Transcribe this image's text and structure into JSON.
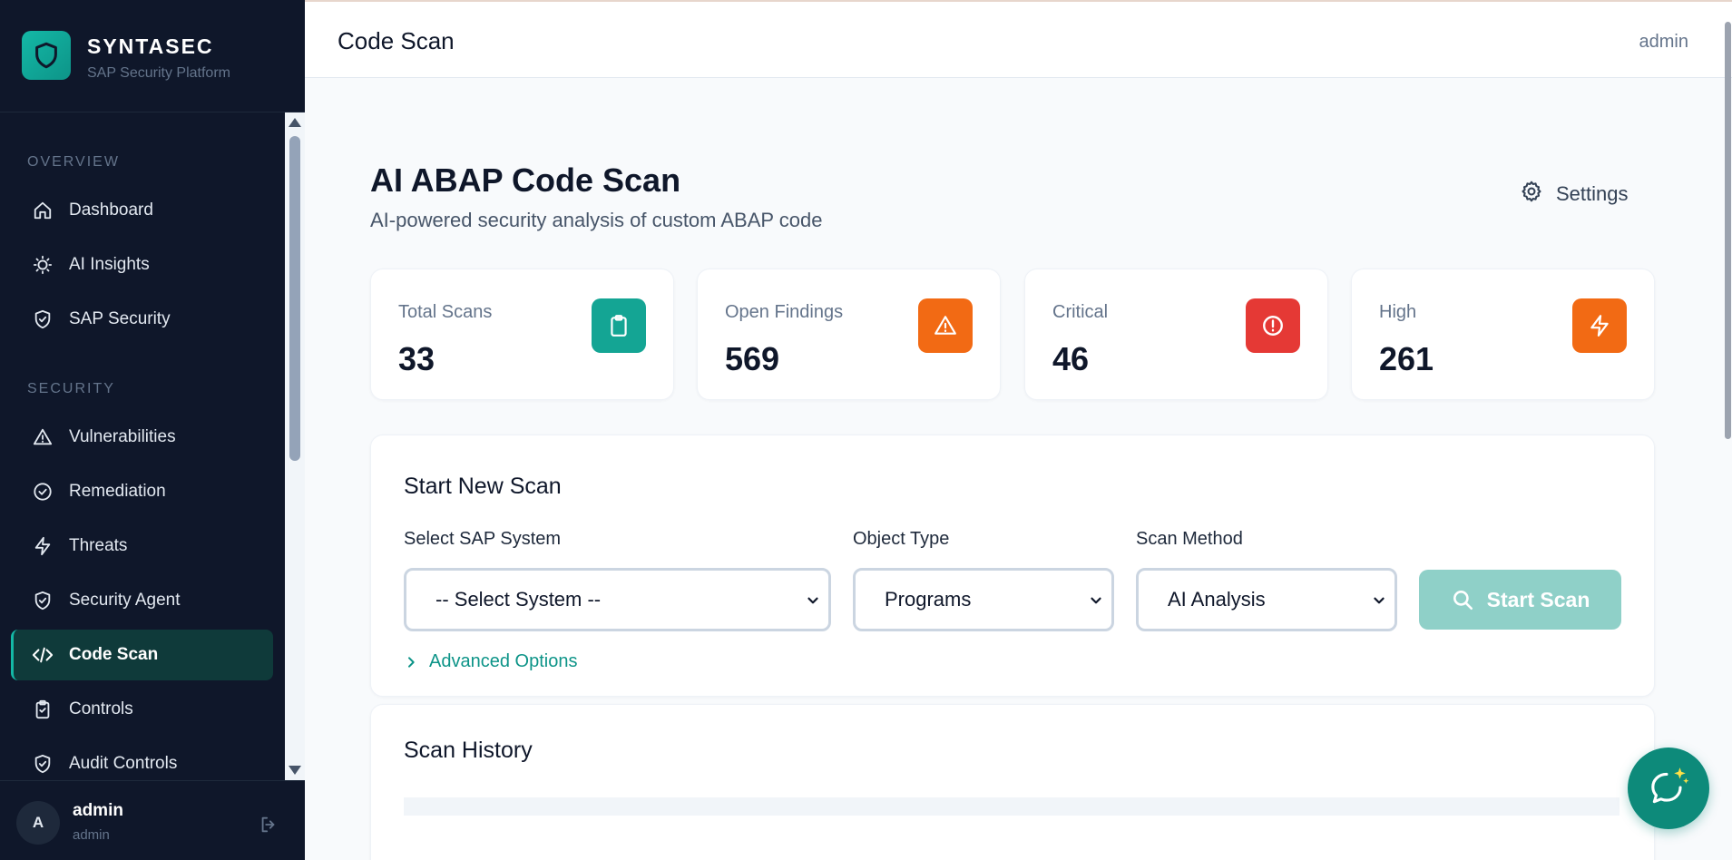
{
  "brand": {
    "name": "SYNTASEC",
    "subtitle": "SAP Security Platform"
  },
  "sidebar": {
    "sections": [
      {
        "label": "OVERVIEW"
      },
      {
        "label": "SECURITY"
      }
    ],
    "items": [
      {
        "label": "Dashboard",
        "icon": "home-icon"
      },
      {
        "label": "AI Insights",
        "icon": "lightbulb-icon"
      },
      {
        "label": "SAP Security",
        "icon": "shield-check-icon"
      },
      {
        "label": "Vulnerabilities",
        "icon": "warning-triangle-icon"
      },
      {
        "label": "Remediation",
        "icon": "check-circle-icon"
      },
      {
        "label": "Threats",
        "icon": "lightning-icon"
      },
      {
        "label": "Security Agent",
        "icon": "shield-check-icon"
      },
      {
        "label": "Code Scan",
        "icon": "code-icon",
        "active": true
      },
      {
        "label": "Controls",
        "icon": "clipboard-check-icon"
      },
      {
        "label": "Audit Controls",
        "icon": "shield-check-icon"
      }
    ],
    "user": {
      "initial": "A",
      "name": "admin",
      "role": "admin"
    }
  },
  "header": {
    "title": "Code Scan",
    "user": "admin"
  },
  "page": {
    "title": "AI ABAP Code Scan",
    "subtitle": "AI-powered security analysis of custom ABAP code",
    "settings_label": "Settings"
  },
  "stats": [
    {
      "label": "Total Scans",
      "value": "33",
      "icon": "clipboard-icon",
      "color": "#14a594"
    },
    {
      "label": "Open Findings",
      "value": "569",
      "icon": "warning-triangle-icon",
      "color": "#f26a14"
    },
    {
      "label": "Critical",
      "value": "46",
      "icon": "alert-circle-icon",
      "color": "#e53935"
    },
    {
      "label": "High",
      "value": "261",
      "icon": "lightning-icon",
      "color": "#f26a14"
    }
  ],
  "new_scan": {
    "title": "Start New Scan",
    "system_label": "Select SAP System",
    "system_value": "-- Select System --",
    "object_label": "Object Type",
    "object_value": "Programs",
    "method_label": "Scan Method",
    "method_value": "AI Analysis",
    "start_label": "Start Scan",
    "advanced_label": "Advanced Options"
  },
  "history": {
    "title": "Scan History"
  },
  "colors": {
    "accent": "#0d9488",
    "sidebar_bg": "#0f172a"
  }
}
